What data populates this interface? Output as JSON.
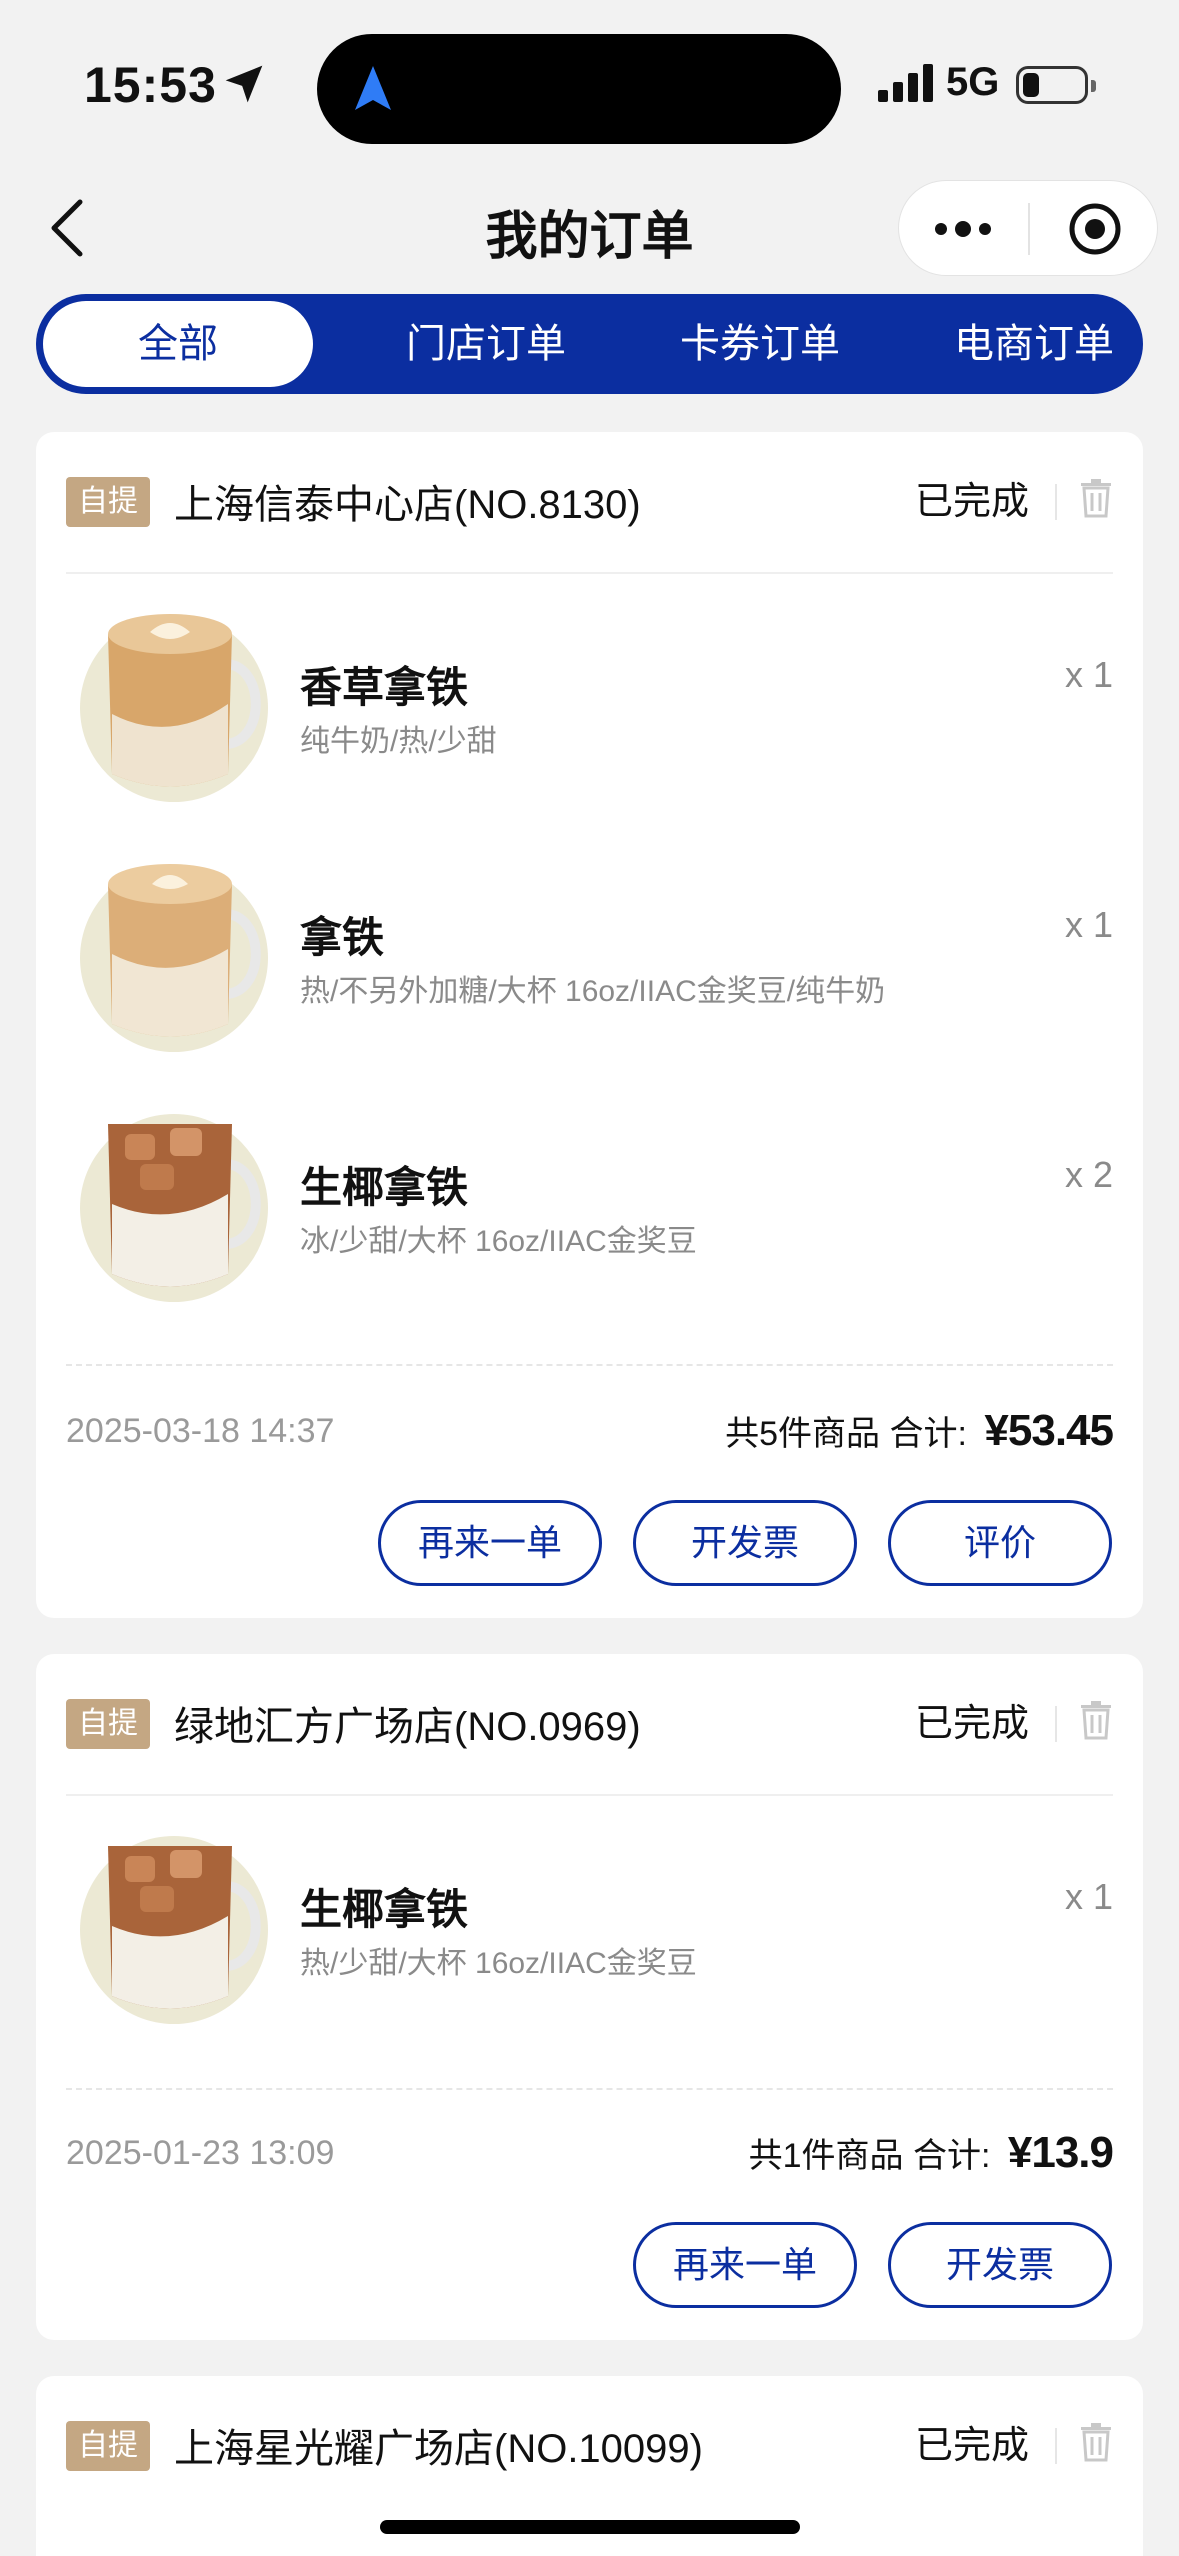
{
  "status_bar": {
    "time": "15:53",
    "network": "5G"
  },
  "nav": {
    "title": "我的订单"
  },
  "tabs": [
    {
      "label": "全部",
      "active": true
    },
    {
      "label": "门店订单",
      "active": false
    },
    {
      "label": "卡券订单",
      "active": false
    },
    {
      "label": "电商订单",
      "active": false
    }
  ],
  "orders": [
    {
      "tag": "自提",
      "store": "上海信泰中心店(NO.8130)",
      "status": "已完成",
      "items": [
        {
          "name": "香草拿铁",
          "spec": "纯牛奶/热/少甜",
          "qty": "x 1",
          "image": "hot-latte"
        },
        {
          "name": "拿铁",
          "spec": "热/不另外加糖/大杯 16oz/IIAC金奖豆/纯牛奶",
          "qty": "x 1",
          "image": "hot-latte"
        },
        {
          "name": "生椰拿铁",
          "spec": "冰/少甜/大杯 16oz/IIAC金奖豆",
          "qty": "x 2",
          "image": "iced-latte"
        }
      ],
      "date": "2025-03-18 14:37",
      "count_text": "共5件商品",
      "total_label": "合计:",
      "price": "¥53.45",
      "buttons": [
        "再来一单",
        "开发票",
        "评价"
      ]
    },
    {
      "tag": "自提",
      "store": "绿地汇方广场店(NO.0969)",
      "status": "已完成",
      "items": [
        {
          "name": "生椰拿铁",
          "spec": "热/少甜/大杯 16oz/IIAC金奖豆",
          "qty": "x 1",
          "image": "iced-latte"
        }
      ],
      "date": "2025-01-23 13:09",
      "count_text": "共1件商品",
      "total_label": "合计:",
      "price": "¥13.9",
      "buttons": [
        "再来一单",
        "开发票"
      ]
    },
    {
      "tag": "自提",
      "store": "上海星光耀广场店(NO.10099)",
      "status": "已完成"
    }
  ],
  "colors": {
    "brand": "#0b2ea0",
    "tag": "#c4a783",
    "background": "#f2f2f2"
  }
}
